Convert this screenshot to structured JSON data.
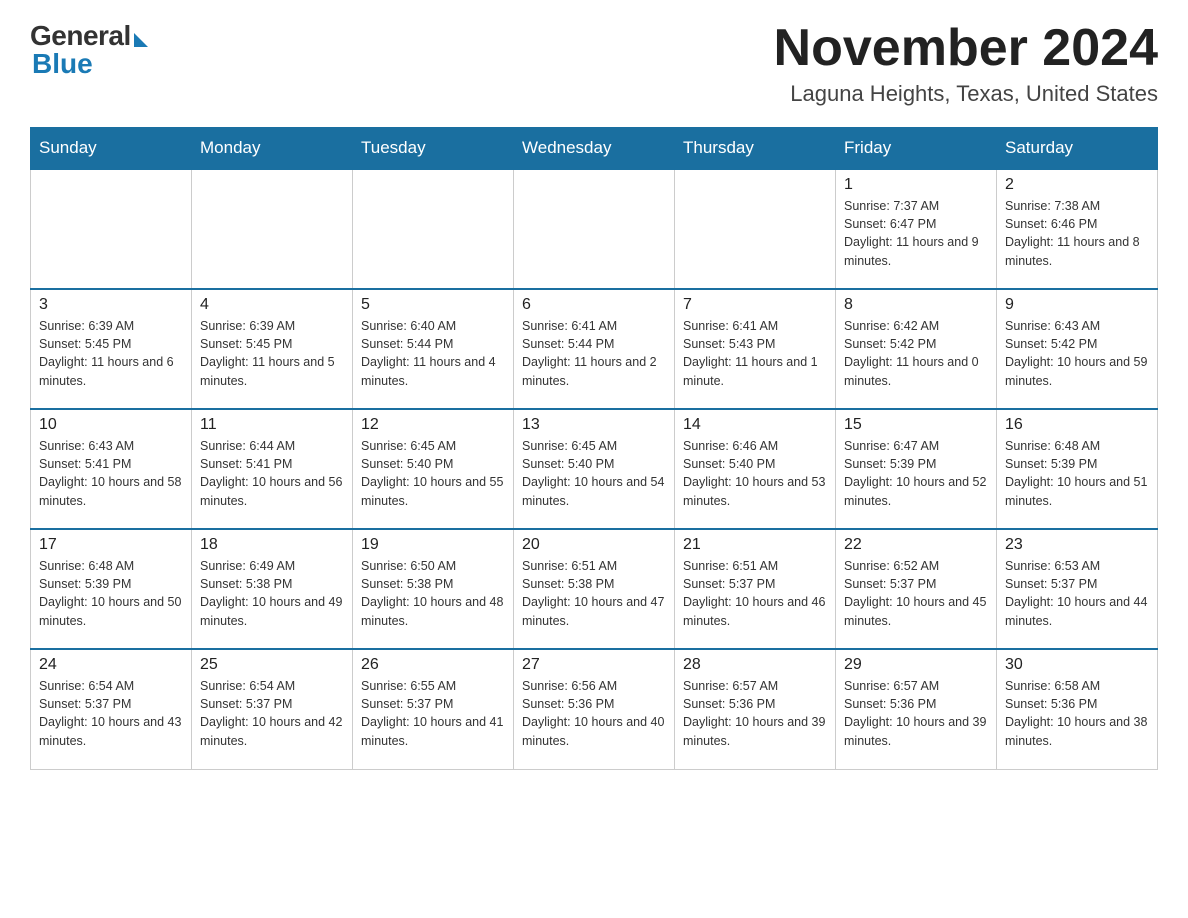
{
  "header": {
    "logo_general": "General",
    "logo_blue": "Blue",
    "month_year": "November 2024",
    "location": "Laguna Heights, Texas, United States"
  },
  "days_of_week": [
    "Sunday",
    "Monday",
    "Tuesday",
    "Wednesday",
    "Thursday",
    "Friday",
    "Saturday"
  ],
  "weeks": [
    [
      {
        "day": "",
        "info": ""
      },
      {
        "day": "",
        "info": ""
      },
      {
        "day": "",
        "info": ""
      },
      {
        "day": "",
        "info": ""
      },
      {
        "day": "",
        "info": ""
      },
      {
        "day": "1",
        "info": "Sunrise: 7:37 AM\nSunset: 6:47 PM\nDaylight: 11 hours and 9 minutes."
      },
      {
        "day": "2",
        "info": "Sunrise: 7:38 AM\nSunset: 6:46 PM\nDaylight: 11 hours and 8 minutes."
      }
    ],
    [
      {
        "day": "3",
        "info": "Sunrise: 6:39 AM\nSunset: 5:45 PM\nDaylight: 11 hours and 6 minutes."
      },
      {
        "day": "4",
        "info": "Sunrise: 6:39 AM\nSunset: 5:45 PM\nDaylight: 11 hours and 5 minutes."
      },
      {
        "day": "5",
        "info": "Sunrise: 6:40 AM\nSunset: 5:44 PM\nDaylight: 11 hours and 4 minutes."
      },
      {
        "day": "6",
        "info": "Sunrise: 6:41 AM\nSunset: 5:44 PM\nDaylight: 11 hours and 2 minutes."
      },
      {
        "day": "7",
        "info": "Sunrise: 6:41 AM\nSunset: 5:43 PM\nDaylight: 11 hours and 1 minute."
      },
      {
        "day": "8",
        "info": "Sunrise: 6:42 AM\nSunset: 5:42 PM\nDaylight: 11 hours and 0 minutes."
      },
      {
        "day": "9",
        "info": "Sunrise: 6:43 AM\nSunset: 5:42 PM\nDaylight: 10 hours and 59 minutes."
      }
    ],
    [
      {
        "day": "10",
        "info": "Sunrise: 6:43 AM\nSunset: 5:41 PM\nDaylight: 10 hours and 58 minutes."
      },
      {
        "day": "11",
        "info": "Sunrise: 6:44 AM\nSunset: 5:41 PM\nDaylight: 10 hours and 56 minutes."
      },
      {
        "day": "12",
        "info": "Sunrise: 6:45 AM\nSunset: 5:40 PM\nDaylight: 10 hours and 55 minutes."
      },
      {
        "day": "13",
        "info": "Sunrise: 6:45 AM\nSunset: 5:40 PM\nDaylight: 10 hours and 54 minutes."
      },
      {
        "day": "14",
        "info": "Sunrise: 6:46 AM\nSunset: 5:40 PM\nDaylight: 10 hours and 53 minutes."
      },
      {
        "day": "15",
        "info": "Sunrise: 6:47 AM\nSunset: 5:39 PM\nDaylight: 10 hours and 52 minutes."
      },
      {
        "day": "16",
        "info": "Sunrise: 6:48 AM\nSunset: 5:39 PM\nDaylight: 10 hours and 51 minutes."
      }
    ],
    [
      {
        "day": "17",
        "info": "Sunrise: 6:48 AM\nSunset: 5:39 PM\nDaylight: 10 hours and 50 minutes."
      },
      {
        "day": "18",
        "info": "Sunrise: 6:49 AM\nSunset: 5:38 PM\nDaylight: 10 hours and 49 minutes."
      },
      {
        "day": "19",
        "info": "Sunrise: 6:50 AM\nSunset: 5:38 PM\nDaylight: 10 hours and 48 minutes."
      },
      {
        "day": "20",
        "info": "Sunrise: 6:51 AM\nSunset: 5:38 PM\nDaylight: 10 hours and 47 minutes."
      },
      {
        "day": "21",
        "info": "Sunrise: 6:51 AM\nSunset: 5:37 PM\nDaylight: 10 hours and 46 minutes."
      },
      {
        "day": "22",
        "info": "Sunrise: 6:52 AM\nSunset: 5:37 PM\nDaylight: 10 hours and 45 minutes."
      },
      {
        "day": "23",
        "info": "Sunrise: 6:53 AM\nSunset: 5:37 PM\nDaylight: 10 hours and 44 minutes."
      }
    ],
    [
      {
        "day": "24",
        "info": "Sunrise: 6:54 AM\nSunset: 5:37 PM\nDaylight: 10 hours and 43 minutes."
      },
      {
        "day": "25",
        "info": "Sunrise: 6:54 AM\nSunset: 5:37 PM\nDaylight: 10 hours and 42 minutes."
      },
      {
        "day": "26",
        "info": "Sunrise: 6:55 AM\nSunset: 5:37 PM\nDaylight: 10 hours and 41 minutes."
      },
      {
        "day": "27",
        "info": "Sunrise: 6:56 AM\nSunset: 5:36 PM\nDaylight: 10 hours and 40 minutes."
      },
      {
        "day": "28",
        "info": "Sunrise: 6:57 AM\nSunset: 5:36 PM\nDaylight: 10 hours and 39 minutes."
      },
      {
        "day": "29",
        "info": "Sunrise: 6:57 AM\nSunset: 5:36 PM\nDaylight: 10 hours and 39 minutes."
      },
      {
        "day": "30",
        "info": "Sunrise: 6:58 AM\nSunset: 5:36 PM\nDaylight: 10 hours and 38 minutes."
      }
    ]
  ]
}
